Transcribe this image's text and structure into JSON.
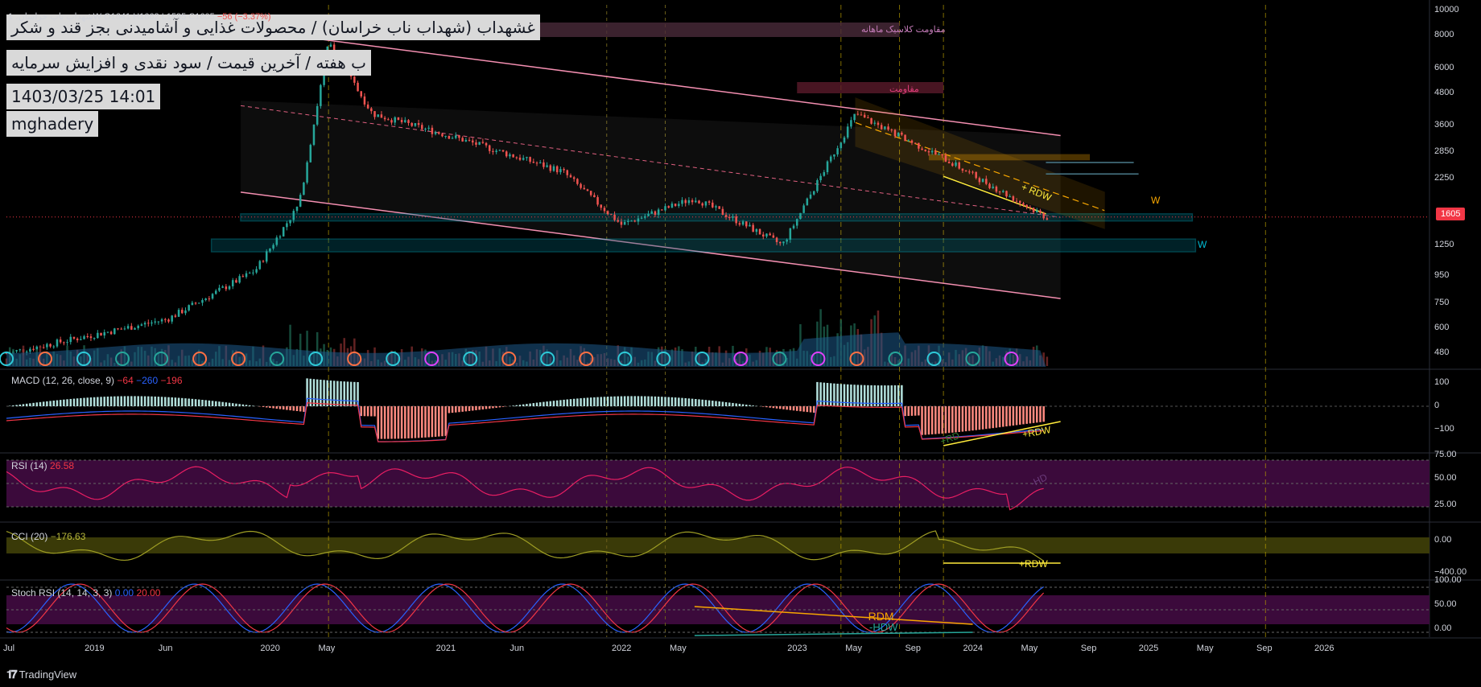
{
  "symbol_header": {
    "name": "شهداب ناب خراسان، 1W",
    "open": "O1641",
    "high": "H1662",
    "low": "L1595",
    "close": "C1605",
    "change": "−56 (−3.37%)"
  },
  "title_lines": [
    "غشهداب (شهداب ناب خراسان) / محصولات غذایی و آشامیدنی بجز قند و شکر",
    "ب هفته / آخرین قیمت / سود نقدی و افزایش سرمایه",
    "1403/03/25 14:01",
    "mghadery"
  ],
  "indicators": {
    "macd": {
      "label": "MACD (12, 26, close, 9)",
      "v1": "−64",
      "v2": "−260",
      "v3": "−196",
      "color1": "#f23645",
      "color2": "#2962ff",
      "color3": "#f23645"
    },
    "rsi": {
      "label": "RSI (14)",
      "value": "26.58",
      "color": "#f23645"
    },
    "cci": {
      "label": "CCI (20)",
      "value": "−176.63",
      "color": "#b5b53a"
    },
    "stoch": {
      "label": "Stoch RSI (14, 14, 3, 3)",
      "v1": "0.00",
      "v2": "20.00",
      "color1": "#2962ff",
      "color2": "#f23645"
    }
  },
  "annotations": {
    "resistance_monthly": "مقاومت کلاسیک ماهانه",
    "resistance": "مقاومت",
    "rdw_price": "+ RDW",
    "rdw_macd": "+RDW",
    "rd_macd": "+RD",
    "hd_rsi": "-HD",
    "rdw_cci": "+RDW",
    "rdm_stoch": "-RDM",
    "hdw_stoch": "-HDW",
    "w_label": "W"
  },
  "footer": {
    "brand": "TradingView"
  },
  "colors": {
    "up": "#26a69a",
    "down": "#ef5350",
    "channel": "#f48fb1",
    "zone": "#00bcd4",
    "orange": "#f7a600",
    "yellow": "#ffeb3b",
    "rsi_band": "#3b0a3b",
    "cci_band": "#3a3a08",
    "volume_ma": "#1e5a8a"
  },
  "chart_data": [
    {
      "type": "candlestick",
      "title": "",
      "scale": "log",
      "price_axis": [
        "10000",
        "8000",
        "6000",
        "4800",
        "3600",
        "2850",
        "2250",
        "1605",
        "1250",
        "950",
        "750",
        "600",
        "480"
      ],
      "time_axis": [
        "Jul",
        "2019",
        "Jun",
        "2020",
        "May",
        "2021",
        "Jun",
        "2022",
        "May",
        "2023",
        "May",
        "Sep",
        "2024",
        "May",
        "Sep",
        "2025",
        "May",
        "Sep",
        "2026"
      ],
      "last_price": "1605",
      "series_keypoints": [
        {
          "date": "2018-07",
          "close": 480
        },
        {
          "date": "2019-06",
          "close": 650
        },
        {
          "date": "2019-12",
          "close": 1000
        },
        {
          "date": "2020-03",
          "close": 1800
        },
        {
          "date": "2020-05",
          "close": 7500
        },
        {
          "date": "2020-08",
          "close": 4000
        },
        {
          "date": "2021-02",
          "close": 3200
        },
        {
          "date": "2021-09",
          "close": 2400
        },
        {
          "date": "2022-01",
          "close": 1500
        },
        {
          "date": "2022-06",
          "close": 1900
        },
        {
          "date": "2022-12",
          "close": 1250
        },
        {
          "date": "2023-05",
          "close": 4000
        },
        {
          "date": "2023-11",
          "close": 2700
        },
        {
          "date": "2024-06",
          "close": 1605
        }
      ],
      "zones": [
        {
          "low": 1550,
          "high": 1650,
          "label": ""
        },
        {
          "low": 1180,
          "high": 1320,
          "label": "W"
        }
      ]
    },
    {
      "type": "line",
      "title": "",
      "axis": [
        "100",
        "0",
        "−100"
      ],
      "series": [
        {
          "values": []
        }
      ]
    },
    {
      "type": "line",
      "title": "",
      "axis": [
        "75.00",
        "50.00",
        "25.00"
      ]
    },
    {
      "type": "line",
      "title": "",
      "axis": [
        "0.00",
        "−400.00"
      ]
    },
    {
      "type": "line",
      "title": "",
      "axis": [
        "100.00",
        "50.00",
        "0.00"
      ]
    }
  ]
}
